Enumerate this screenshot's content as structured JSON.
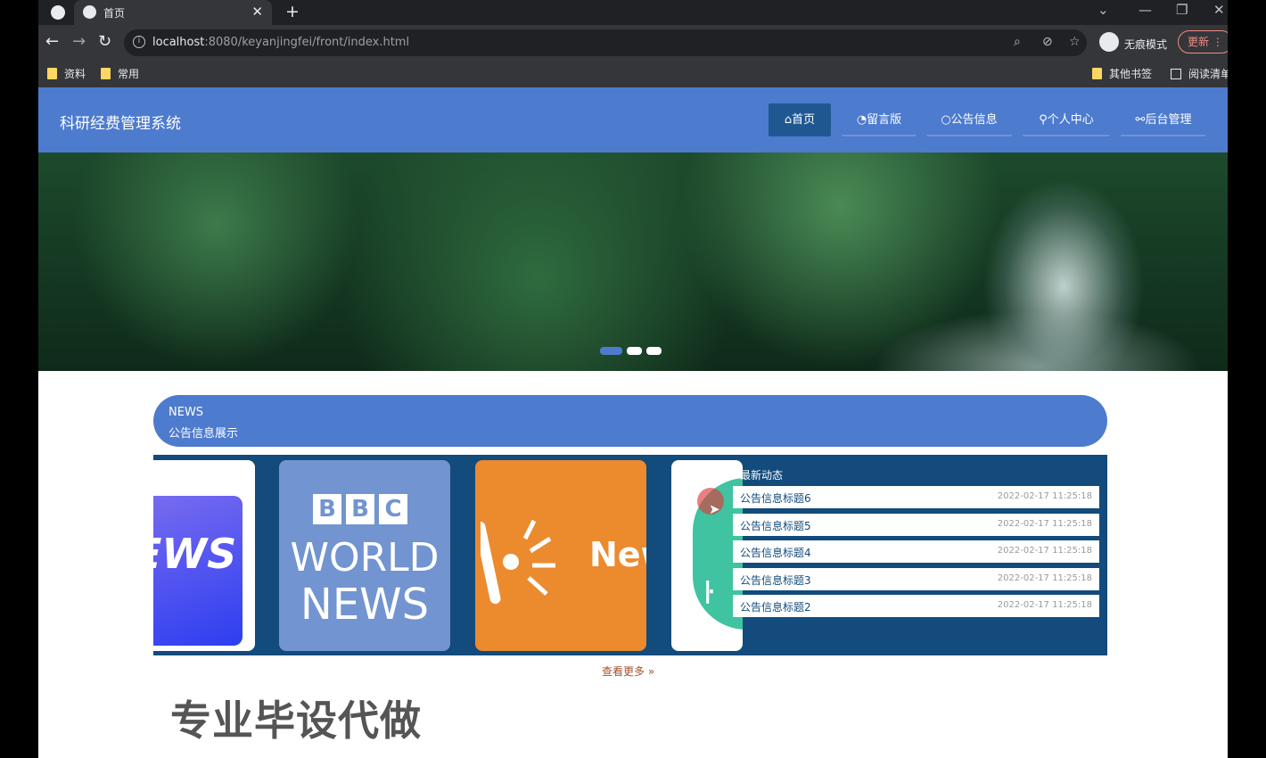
{
  "browser": {
    "tab_title": "首页",
    "url_host": "localhost",
    "url_path": ":8080/keyanjingfei/front/index.html",
    "profile_label": "无痕模式",
    "update_label": "更新",
    "bookmarks": [
      "资料",
      "常用"
    ],
    "other_bookmarks": "其他书签",
    "reading_list": "阅读清单"
  },
  "site": {
    "title": "科研经费管理系统",
    "nav": [
      {
        "icon": "home-icon",
        "label": "首页"
      },
      {
        "icon": "message-icon",
        "label": "留言版"
      },
      {
        "icon": "circle-icon",
        "label": "公告信息"
      },
      {
        "icon": "user-icon",
        "label": "个人中心"
      },
      {
        "icon": "link-icon",
        "label": "后台管理"
      }
    ],
    "active_nav": 0
  },
  "banner": {
    "slide_count": 3,
    "active_slide": 0
  },
  "news": {
    "label_en": "NEWS",
    "label_cn": "公告信息展示",
    "cards": [
      {
        "name": "news-image-1",
        "text": "EWS"
      },
      {
        "name": "news-image-bbc",
        "bbc": [
          "B",
          "B",
          "C"
        ],
        "line1": "WORLD",
        "line2": "NEWS"
      },
      {
        "name": "news-image-3",
        "text": "New"
      },
      {
        "name": "news-image-4",
        "text": "ŀ"
      }
    ],
    "latest_title": "最新动态",
    "items": [
      {
        "title": "公告信息标题6",
        "date": "2022-02-17 11:25:18"
      },
      {
        "title": "公告信息标题5",
        "date": "2022-02-17 11:25:18"
      },
      {
        "title": "公告信息标题4",
        "date": "2022-02-17 11:25:18"
      },
      {
        "title": "公告信息标题3",
        "date": "2022-02-17 11:25:18"
      },
      {
        "title": "公告信息标题2",
        "date": "2022-02-17 11:25:18"
      }
    ],
    "more_label": "查看更多",
    "more_icon": "»"
  },
  "watermark": "专业毕设代做",
  "colors": {
    "header": "#4d7bce",
    "nav_active": "#1f5891",
    "panel": "#124b7c"
  }
}
